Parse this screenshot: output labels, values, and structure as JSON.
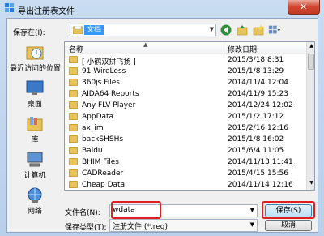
{
  "window": {
    "title": "导出注册表文件",
    "close_label": "✕"
  },
  "save_in": {
    "label": "保存在(I):",
    "value": "文档"
  },
  "places": [
    {
      "label": "最近访问的位置"
    },
    {
      "label": "桌面"
    },
    {
      "label": "库"
    },
    {
      "label": "计算机"
    },
    {
      "label": "网络"
    }
  ],
  "list": {
    "col_name": "名称",
    "col_date": "修改日期",
    "rows": [
      {
        "name": "[ 小鹤双拼飞扬 ]",
        "date": "2015/3/18 8:31"
      },
      {
        "name": "91 WireLess",
        "date": "2015/1/8 13:29"
      },
      {
        "name": "360js Files",
        "date": "2014/11/4 12:04"
      },
      {
        "name": "AIDA64 Reports",
        "date": "2014/11/9 15:23"
      },
      {
        "name": "Any FLV Player",
        "date": "2014/12/24 12:02"
      },
      {
        "name": "AppData",
        "date": "2015/1/2 17:12"
      },
      {
        "name": "ax_im",
        "date": "2015/2/16 12:16"
      },
      {
        "name": "backSHSHs",
        "date": "2015/1/8 16:02"
      },
      {
        "name": "Baidu",
        "date": "2015/6/4 11:05"
      },
      {
        "name": "BHIM Files",
        "date": "2014/11/13 11:41"
      },
      {
        "name": "CADReader",
        "date": "2015/4/15 15:56"
      },
      {
        "name": "Cheap Data",
        "date": "2014/11/14 12:16"
      }
    ]
  },
  "filename": {
    "label": "文件名(N):",
    "value": "wdata"
  },
  "filetype": {
    "label": "保存类型(T):",
    "value": "注册文件 (*.reg)"
  },
  "buttons": {
    "save": "保存(S)",
    "cancel": "取消"
  }
}
